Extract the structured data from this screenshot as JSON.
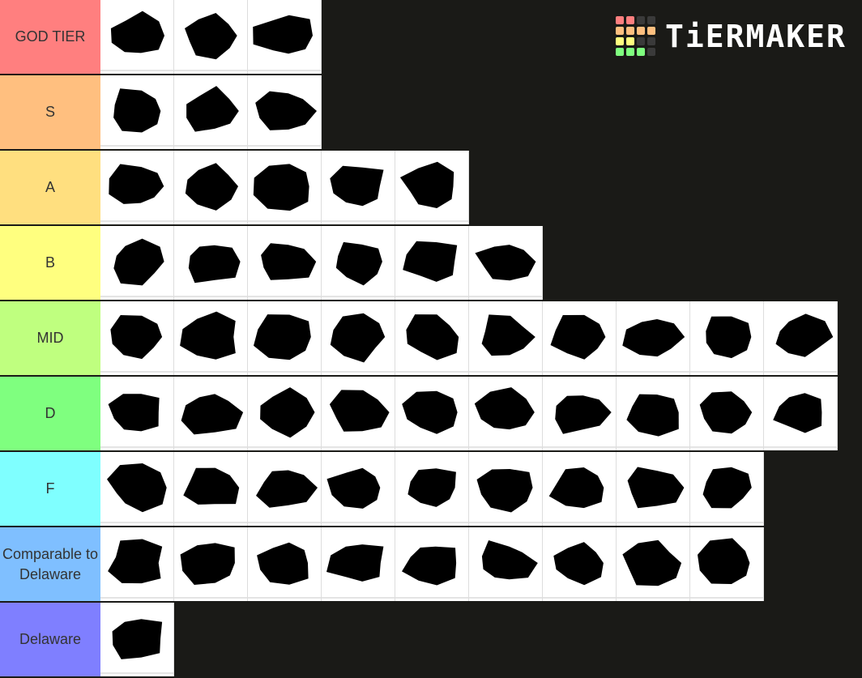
{
  "logo": {
    "text": "TiERMAKER",
    "grid_colors": [
      "#ff7f7f",
      "#ff7f7f",
      "#3a3a3a",
      "#3a3a3a",
      "#ffbf7f",
      "#ffbf7f",
      "#ffbf7f",
      "#ffbf7f",
      "#ffff7f",
      "#ffff7f",
      "#3a3a3a",
      "#3a3a3a",
      "#7fff7f",
      "#7fff7f",
      "#7fff7f",
      "#3a3a3a"
    ]
  },
  "tiers": [
    {
      "label": "GOD TIER",
      "color": "#ff7f7f",
      "items": [
        "virginia",
        "washington",
        "pennsylvania"
      ]
    },
    {
      "label": "S",
      "color": "#ffbf7f",
      "items": [
        "puerto-rico-or-guam",
        "vermont",
        "wisconsin"
      ]
    },
    {
      "label": "A",
      "color": "#ffdf7f",
      "items": [
        "hawaii",
        "new-jersey",
        "new-york",
        "oregon",
        "puerto-rico"
      ]
    },
    {
      "label": "B",
      "color": "#ffff7f",
      "items": [
        "alaska",
        "guam",
        "massachusetts",
        "nevada",
        "texas",
        "us-virgin-islands"
      ]
    },
    {
      "label": "MID",
      "color": "#bfff7f",
      "items": [
        "wyoming",
        "florida",
        "georgia",
        "illinois",
        "iowa",
        "arizona",
        "new-hampshire",
        "northern-mariana-islands",
        "rhode-island",
        "tennessee"
      ]
    },
    {
      "label": "D",
      "color": "#7fff7f",
      "items": [
        "alabama",
        "california",
        "maine",
        "minnesota",
        "north-carolina",
        "north-dakota",
        "oklahoma",
        "south-carolina",
        "south-dakota",
        "colorado"
      ]
    },
    {
      "label": "F",
      "color": "#7fffff",
      "items": [
        "district-of-columbia",
        "kentucky",
        "louisiana",
        "maryland",
        "michigan",
        "mississippi",
        "missouri",
        "ohio",
        "utah"
      ]
    },
    {
      "label": "Comparable to Delaware",
      "color": "#7fbfff",
      "items": [
        "arkansas",
        "connecticut",
        "idaho",
        "indiana",
        "kansas",
        "montana",
        "nebraska",
        "new-mexico",
        "west-virginia"
      ]
    },
    {
      "label": "Delaware",
      "color": "#7f7fff",
      "items": [
        "delaware"
      ]
    }
  ]
}
